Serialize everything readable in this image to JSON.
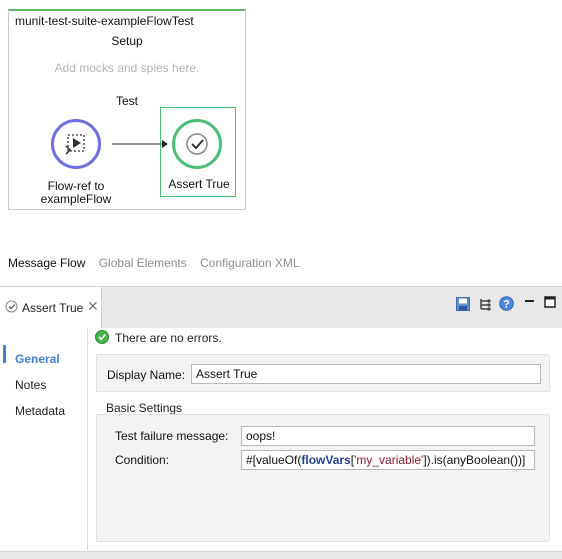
{
  "flow": {
    "title": "munit-test-suite-exampleFlowTest",
    "setup_label": "Setup",
    "setup_hint": "Add mocks and spies here.",
    "test_label": "Test",
    "nodes": [
      {
        "label_line1": "Flow-ref to",
        "label_line2": "exampleFlow",
        "icon": "flow-ref-icon",
        "ring_color": "#6b6fe0"
      },
      {
        "label": "Assert True",
        "icon": "assert-check-icon",
        "ring_color": "#4cbf74",
        "selected": true
      }
    ]
  },
  "editor_tabs": [
    {
      "label": "Message Flow",
      "active": true
    },
    {
      "label": "Global Elements",
      "active": false
    },
    {
      "label": "Configuration XML",
      "active": false
    }
  ],
  "properties": {
    "tab_title": "Assert True",
    "toolbar_icons": [
      "save-icon",
      "tree-icon",
      "help-icon",
      "minimize-icon",
      "maximize-icon"
    ],
    "status_message": "There are no errors.",
    "nav": [
      {
        "label": "General",
        "active": true
      },
      {
        "label": "Notes",
        "active": false
      },
      {
        "label": "Metadata",
        "active": false
      }
    ],
    "display_name_label": "Display Name:",
    "display_name_value": "Assert True",
    "basic_settings_title": "Basic Settings",
    "failure_message_label": "Test failure message:",
    "failure_message_value": "oops!",
    "condition_label": "Condition:",
    "condition_parts": {
      "prefix": "#[valueOf(",
      "keyword": "flowVars",
      "open": "[",
      "string": "'my_variable'",
      "suffix": "]).is(anyBoolean())]"
    }
  },
  "colors": {
    "accent": "#3f7fd6",
    "flow_border": "#5cb85c",
    "ok_green": "#45b549"
  }
}
